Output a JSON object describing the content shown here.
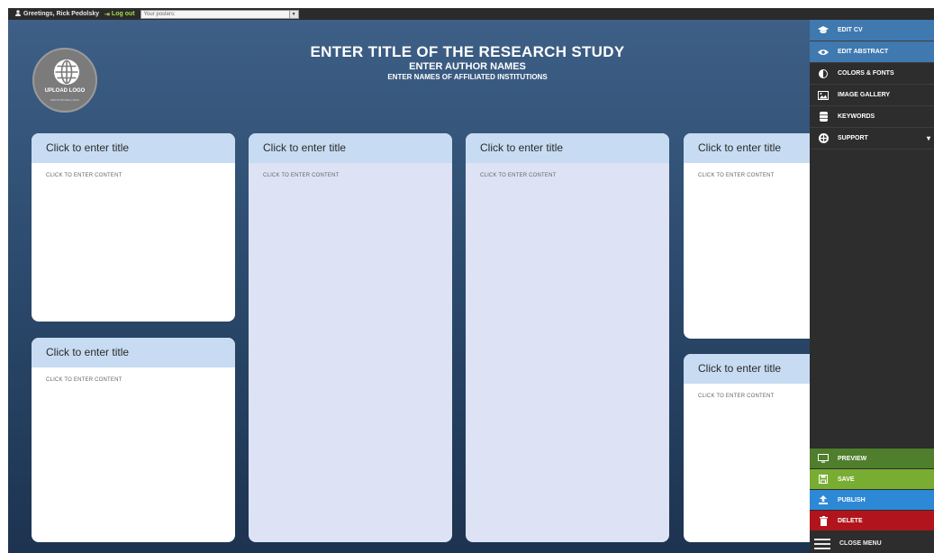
{
  "topbar": {
    "greeting": "Greetings, Rick Pedolsky",
    "logout": "Log out",
    "posters_select": "Your posters:"
  },
  "logo": {
    "label": "UPLOAD LOGO",
    "sub": "INSTITUTIONAL LOGO"
  },
  "header": {
    "title": "ENTER TITLE OF THE RESEARCH STUDY",
    "authors": "ENTER AUTHOR NAMES",
    "institutions": "ENTER NAMES OF AFFILIATED INSTITUTIONS"
  },
  "panels": [
    {
      "title": "Click to enter title",
      "content": "CLICK TO ENTER CONTENT"
    },
    {
      "title": "Click to enter title",
      "content": "CLICK TO ENTER CONTENT"
    },
    {
      "title": "Click to enter title",
      "content": "CLICK TO ENTER CONTENT"
    },
    {
      "title": "Click to enter title",
      "content": "CLICK TO ENTER CONTENT"
    },
    {
      "title": "Click to enter title",
      "content": "CLICK TO ENTER CONTENT"
    },
    {
      "title": "Click to enter title",
      "content": "CLICK TO ENTER CONTENT"
    }
  ],
  "sidebar": {
    "items": [
      {
        "label": "EDIT CV",
        "icon": "graduation-cap-icon"
      },
      {
        "label": "EDIT ABSTRACT",
        "icon": "eye-icon"
      },
      {
        "label": "COLORS & FONTS",
        "icon": "contrast-icon"
      },
      {
        "label": "IMAGE GALLERY",
        "icon": "image-icon"
      },
      {
        "label": "KEYWORDS",
        "icon": "database-icon"
      },
      {
        "label": "SUPPORT",
        "icon": "lifebuoy-icon"
      }
    ],
    "actions": {
      "preview": "PREVIEW",
      "save": "SAVE",
      "publish": "PUBLISH",
      "delete": "DELETE"
    },
    "close_menu": "CLOSE MENU"
  },
  "colors": {
    "canvas_top": "#3e5f86",
    "canvas_bottom": "#1d3350",
    "panel_header": "#c7dcf2",
    "sidebar_active": "#3f79b0",
    "preview_green": "#4f7e2c",
    "save_green": "#79ad32",
    "publish_blue": "#2d89d6",
    "delete_red": "#b1141c"
  }
}
